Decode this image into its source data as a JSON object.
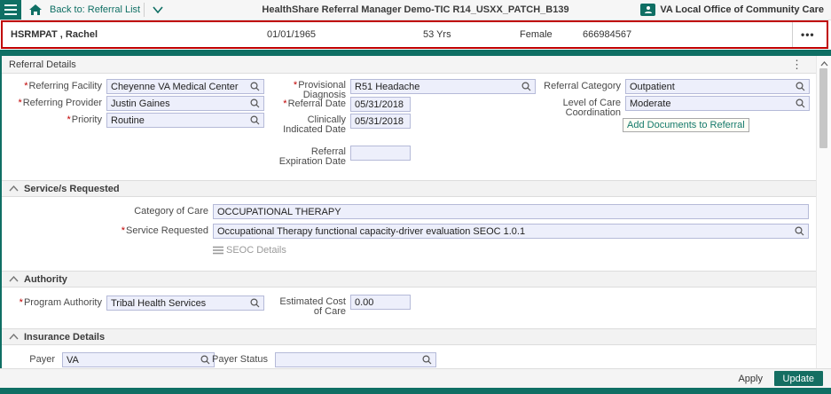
{
  "colors": {
    "teal": "#0f6f64",
    "annotation_red": "#c00000",
    "field_bg": "#edeffb",
    "update_button": "#146e62"
  },
  "icons": {
    "kebab": "⋮",
    "more": "•••"
  },
  "marks": {
    "required": "*"
  },
  "topbar": {
    "back_label": "Back to: Referral List",
    "title": "HealthShare Referral Manager Demo-TIC R14_USXX_PATCH_B139",
    "office_label": "VA Local Office of Community Care"
  },
  "patient": {
    "name": "HSRMPAT , Rachel",
    "dob": "01/01/1965",
    "age": "53 Yrs",
    "gender": "Female",
    "id": "666984567"
  },
  "referral_details": {
    "title": "Referral Details",
    "tooltip": "Add Documents to Referral",
    "fields": {
      "referring_facility": {
        "label": "Referring Facility",
        "value": "Cheyenne VA Medical Center",
        "required": true
      },
      "referring_provider": {
        "label": "Referring Provider",
        "value": "Justin Gaines",
        "required": true
      },
      "priority": {
        "label": "Priority",
        "value": "Routine",
        "required": true
      },
      "provisional_diagnosis": {
        "label": "Provisional Diagnosis",
        "value": "R51 Headache",
        "required": true
      },
      "referral_date": {
        "label": "Referral Date",
        "value": "05/31/2018",
        "required": true
      },
      "clinically_indicated_date": {
        "label": "Clinically Indicated Date",
        "value": "05/31/2018",
        "required": false
      },
      "referral_expiration_date": {
        "label": "Referral Expiration Date",
        "value": "",
        "required": false
      },
      "referral_category": {
        "label": "Referral Category",
        "value": "Outpatient",
        "required": false
      },
      "level_of_care": {
        "label": "Level of Care Coordination",
        "value": "Moderate",
        "required": false
      }
    }
  },
  "services": {
    "title": "Service/s Requested",
    "category_of_care": {
      "label": "Category of Care",
      "value": "OCCUPATIONAL THERAPY",
      "required": false
    },
    "service_requested": {
      "label": "Service Requested",
      "value": "Occupational Therapy functional capacity-driver evaluation SEOC 1.0.1",
      "required": true
    },
    "seoc_details_label": "SEOC Details"
  },
  "authority": {
    "title": "Authority",
    "program_authority": {
      "label": "Program Authority",
      "value": "Tribal Health Services",
      "required": true
    },
    "estimated_cost": {
      "label": "Estimated Cost of Care",
      "value": "0.00",
      "required": false
    }
  },
  "insurance": {
    "title": "Insurance Details",
    "payer": {
      "label": "Payer",
      "value": "VA",
      "required": false
    },
    "payer_status": {
      "label": "Payer Status",
      "value": "",
      "required": false
    }
  },
  "footer": {
    "apply_label": "Apply",
    "update_label": "Update"
  }
}
